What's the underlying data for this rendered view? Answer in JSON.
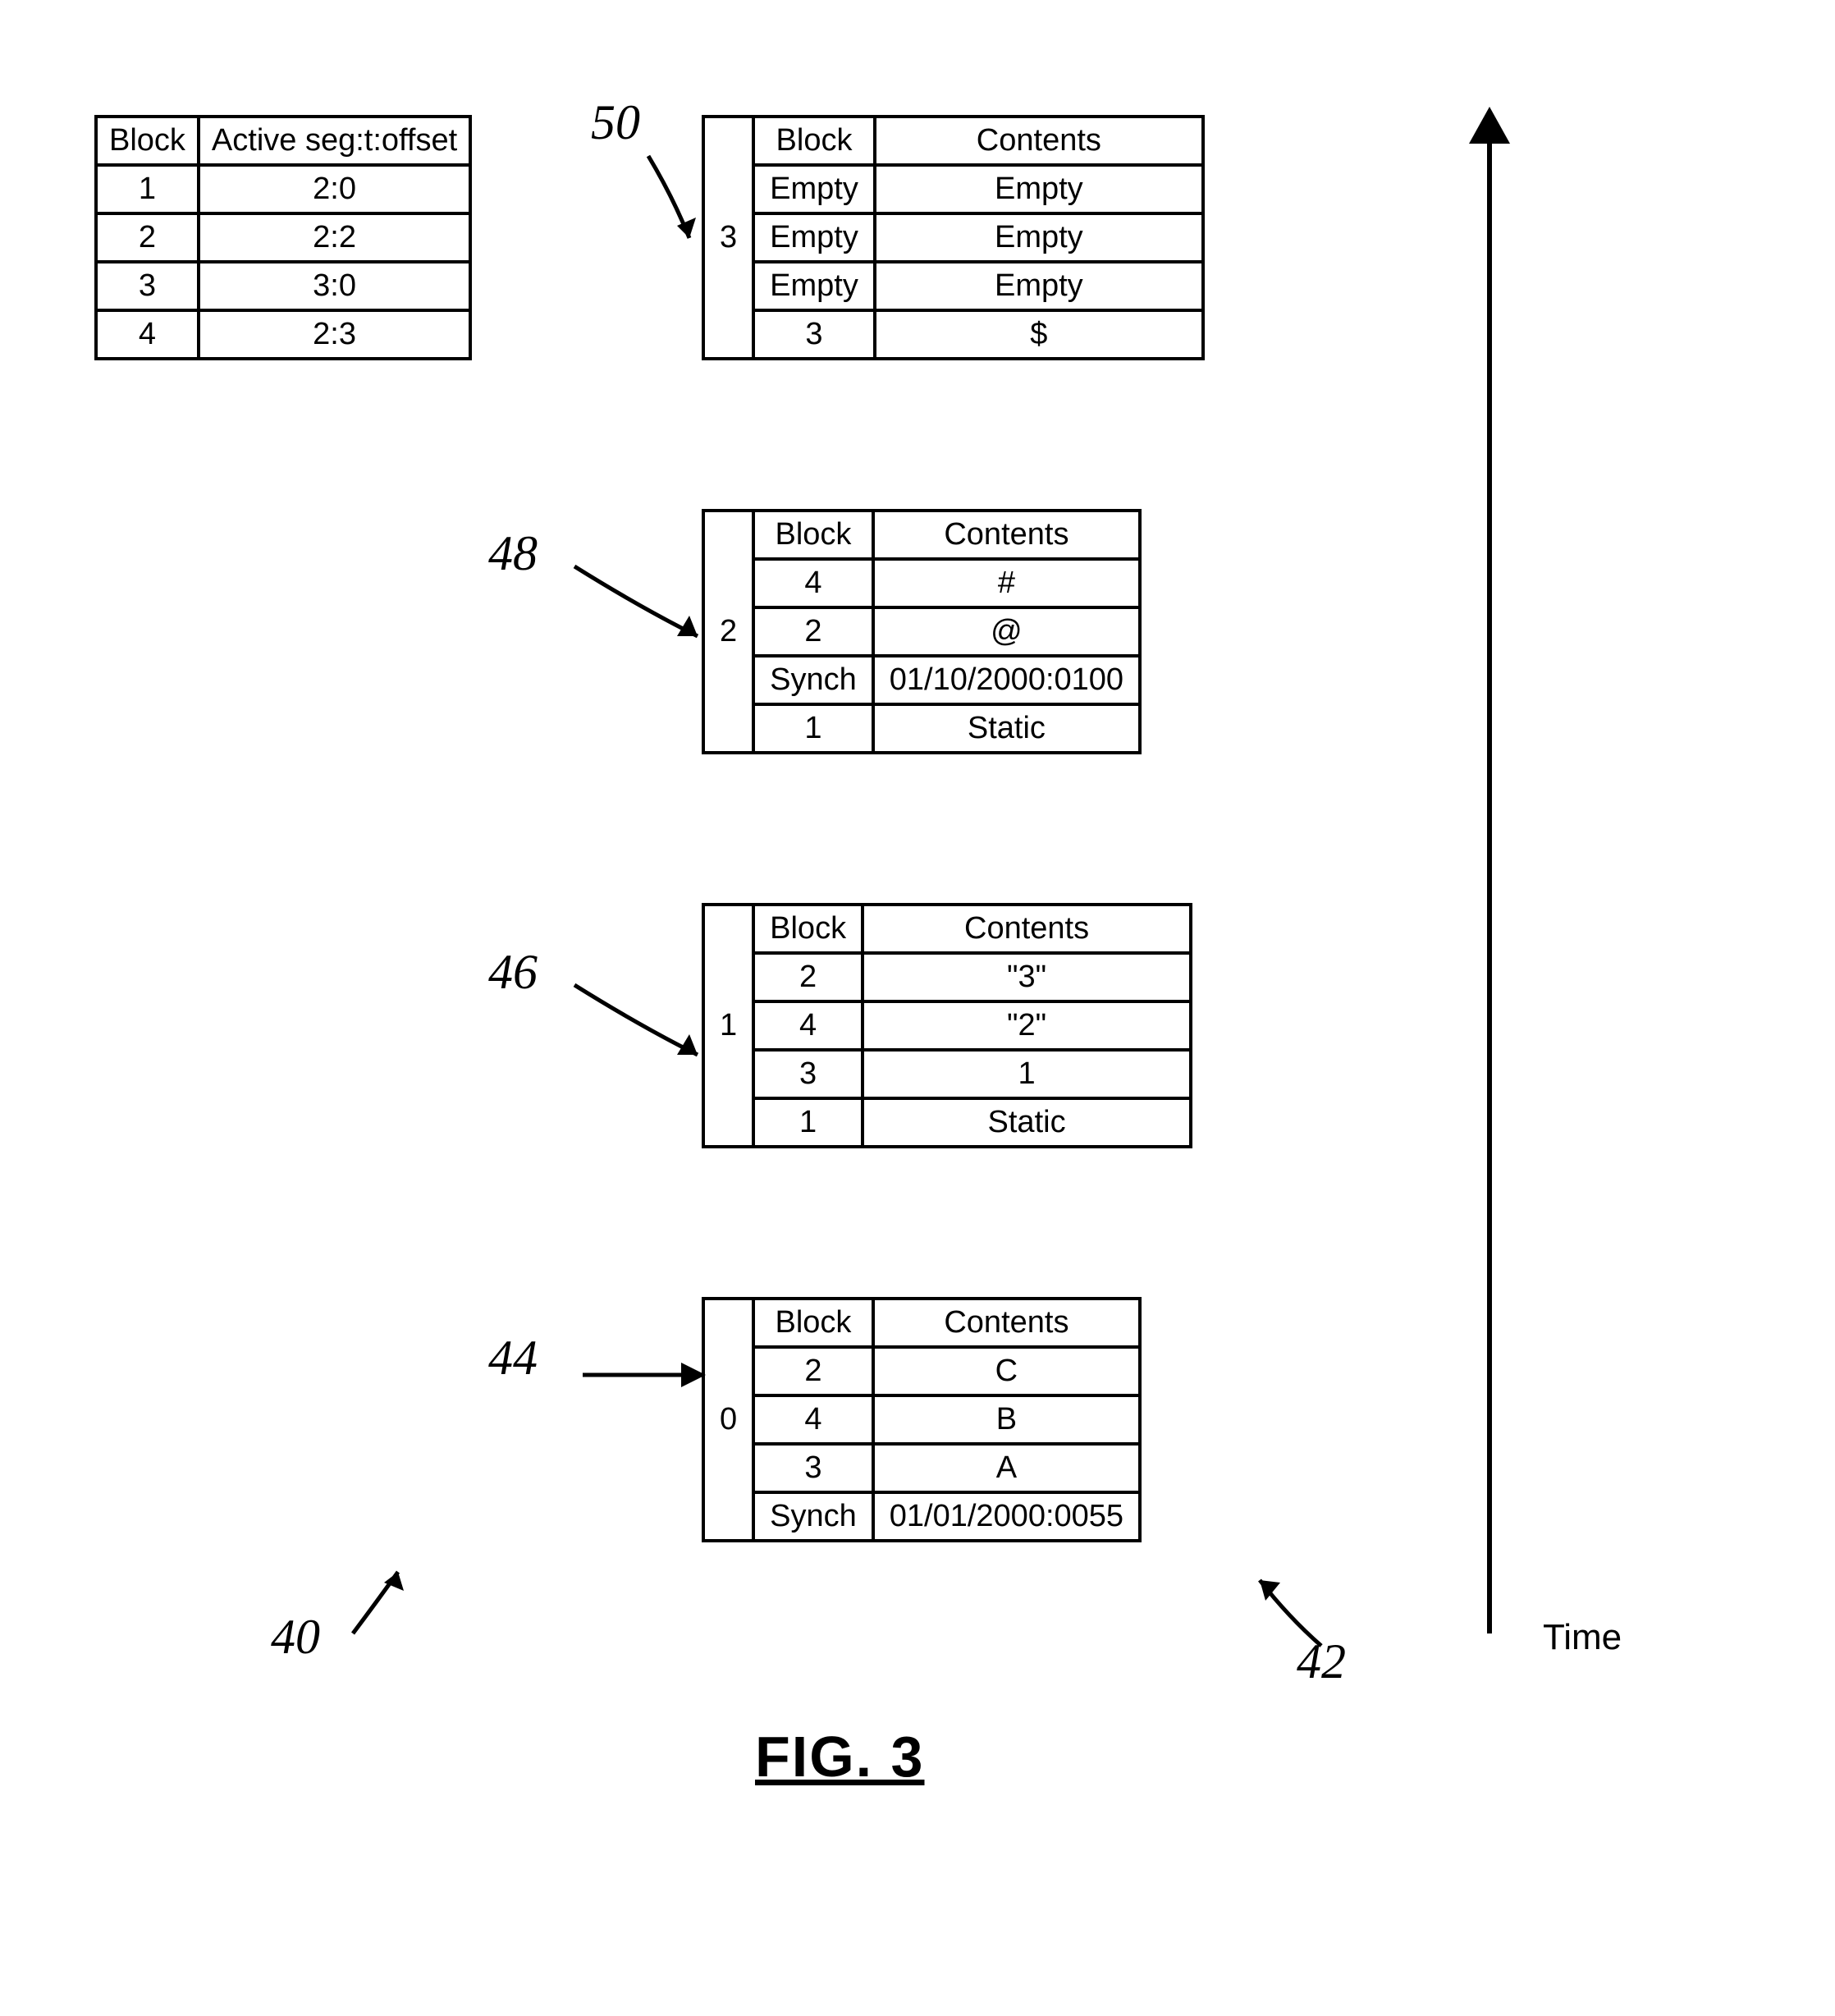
{
  "figure_label": "FIG. 3",
  "time_axis_label": "Time",
  "callouts": {
    "c40": "40",
    "c42": "42",
    "c44": "44",
    "c46": "46",
    "c48": "48",
    "c50": "50"
  },
  "lookup": {
    "h_block": "Block",
    "h_active": "Active seg:t:offset",
    "rows": [
      {
        "b": "1",
        "a": "2:0"
      },
      {
        "b": "2",
        "a": "2:2"
      },
      {
        "b": "3",
        "a": "3:0"
      },
      {
        "b": "4",
        "a": "2:3"
      }
    ]
  },
  "segments": {
    "s3": {
      "num": "3",
      "h_block": "Block",
      "h_contents": "Contents",
      "rows": [
        {
          "b": "Empty",
          "c": "Empty"
        },
        {
          "b": "Empty",
          "c": "Empty"
        },
        {
          "b": "Empty",
          "c": "Empty"
        },
        {
          "b": "3",
          "c": "$"
        }
      ]
    },
    "s2": {
      "num": "2",
      "h_block": "Block",
      "h_contents": "Contents",
      "rows": [
        {
          "b": "4",
          "c": "#"
        },
        {
          "b": "2",
          "c": "@"
        },
        {
          "b": "Synch",
          "c": "01/10/2000:0100"
        },
        {
          "b": "1",
          "c": "Static"
        }
      ]
    },
    "s1": {
      "num": "1",
      "h_block": "Block",
      "h_contents": "Contents",
      "rows": [
        {
          "b": "2",
          "c": "\"3\""
        },
        {
          "b": "4",
          "c": "\"2\""
        },
        {
          "b": "3",
          "c": "1"
        },
        {
          "b": "1",
          "c": "Static"
        }
      ]
    },
    "s0": {
      "num": "0",
      "h_block": "Block",
      "h_contents": "Contents",
      "rows": [
        {
          "b": "2",
          "c": "C"
        },
        {
          "b": "4",
          "c": "B"
        },
        {
          "b": "3",
          "c": "A"
        },
        {
          "b": "Synch",
          "c": "01/01/2000:0055"
        }
      ]
    }
  }
}
